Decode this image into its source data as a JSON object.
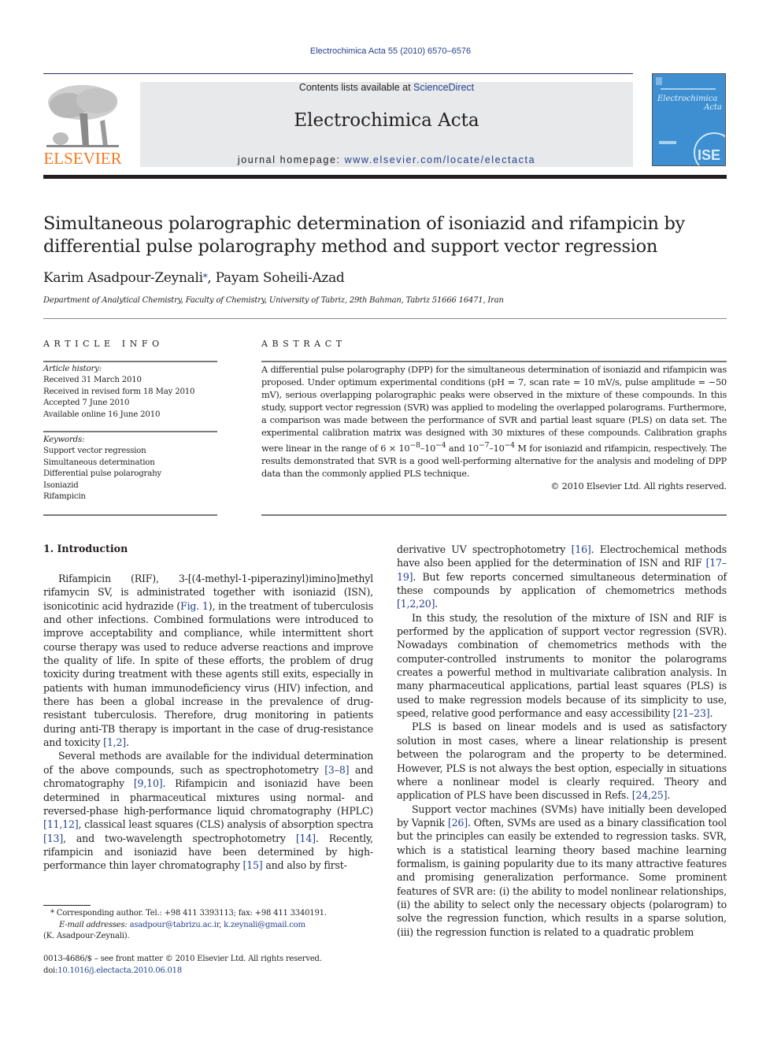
{
  "header": {
    "citation": "Electrochimica Acta 55 (2010) 6570–6576",
    "publisher_logo_text": "ELSEVIER",
    "contents_prefix": "Contents lists available at ",
    "contents_link": "ScienceDirect",
    "journal_title": "Electrochimica Acta",
    "homepage_prefix": "journal homepage: ",
    "homepage_link": "www.elsevier.com/locate/electacta",
    "cover": {
      "title_line1": "Electrochimica",
      "title_line2": "Acta",
      "seal_text": "ISE"
    }
  },
  "article": {
    "title": "Simultaneous polarographic determination of isoniazid and rifampicin by differential pulse polarography method and support vector regression",
    "authors": {
      "author1": "Karim Asadpour-Zeynali",
      "author1_mark": "*",
      "separator": ", ",
      "author2": "Payam Soheili-Azad"
    },
    "affiliation": "Department of Analytical Chemistry, Faculty of Chemistry, University of Tabriz, 29th Bahman, Tabriz 51666 16471, Iran"
  },
  "article_info": {
    "heading": "ARTICLE INFO",
    "history_label": "Article history:",
    "history": [
      "Received 31 March 2010",
      "Received in revised form 18 May 2010",
      "Accepted 7 June 2010",
      "Available online 16 June 2010"
    ],
    "keywords_label": "Keywords:",
    "keywords": [
      "Support vector regression",
      "Simultaneous determination",
      "Differential pulse polarograhy",
      "Isoniazid",
      "Rifampicin"
    ]
  },
  "abstract": {
    "heading": "ABSTRACT",
    "text_part1": "A differential pulse polarography (DPP) for the simultaneous determination of isoniazid and rifampicin was proposed. Under optimum experimental conditions (pH = 7, scan rate = 10 mV/s, pulse amplitude = −50 mV), serious overlapping polarographic peaks were observed in the mixture of these compounds. In this study, support vector regression (SVR) was applied to modeling the overlapped polarograms. Furthermore, a comparison was made between the performance of SVR and partial least square (PLS) on data set. The experimental calibration matrix was designed with 30 mixtures of these compounds. Calibration graphs were linear in the range of 6 × 10",
    "exp1": "−8",
    "text_part2": "–10",
    "exp2": "−4",
    "text_part3": " and 10",
    "exp3": "−7",
    "text_part4": "–10",
    "exp4": "−4",
    "text_part5": " M for isoniazid and rifampicin, respectively. The results demonstrated that SVR is a good well-performing alternative for the analysis and modeling of DPP data than the commonly applied PLS technique.",
    "copyright": "© 2010 Elsevier Ltd. All rights reserved."
  },
  "introduction": {
    "heading": "1.  Introduction",
    "p1": {
      "a": "Rifampicin (RIF), 3-[(4-methyl-1-piperazinyl)imino]methyl rifamycin SV, is administrated together with isoniazid (ISN), isonicotinic acid hydrazide (",
      "ref1": "Fig. 1",
      "b": "), in the treatment of tuberculosis and other infections. Combined formulations were introduced to improve acceptability and compliance, while intermittent short course therapy was used to reduce adverse reactions and improve the quality of life. In spite of these efforts, the problem of drug toxicity during treatment with these agents still exits, especially in patients with human immunodeficiency virus (HIV) infection, and there has been a global increase in the prevalence of drug-resistant tuberculosis. Therefore, drug monitoring in patients during anti-TB therapy is important in the case of drug-resistance and toxicity ",
      "ref2": "[1,2]",
      "c": "."
    },
    "p2": {
      "a": "Several methods are available for the individual determination of the above compounds, such as spectrophotometry ",
      "ref1": "[3–8]",
      "b": " and chromatography ",
      "ref2": "[9,10]",
      "c": ". Rifampicin and isoniazid have been determined in pharmaceutical mixtures using normal- and reversed-phase high-performance liquid chromatography (HPLC) ",
      "ref3": "[11,12]",
      "d": ", classical least squares (CLS) analysis of absorption spectra ",
      "ref4": "[13]",
      "e": ", and two-wavelength spectrophotometry ",
      "ref5": "[14]",
      "f": ". Recently, rifampicin and isoniazid have been determined by high-performance thin layer chromatography ",
      "ref6": "[15]",
      "g": " and also by first-"
    },
    "p3": {
      "a": "derivative UV spectrophotometry ",
      "ref1": "[16]",
      "b": ". Electrochemical methods have also been applied for the determination of ISN and RIF ",
      "ref2": "[17–19]",
      "c": ". But few reports concerned simultaneous determination of these compounds by application of chemometrics methods ",
      "ref3": "[1,2,20]",
      "d": "."
    },
    "p4": {
      "a": "In this study, the resolution of the mixture of ISN and RIF is performed by the application of support vector regression (SVR). Nowadays combination of chemometrics methods with the computer-controlled instruments to monitor the polarograms creates a powerful method in multivariate calibration analysis. In many pharmaceutical applications, partial least squares (PLS) is used to make regression models because of its simplicity to use, speed, relative good performance and easy accessibility ",
      "ref1": "[21–23]",
      "b": "."
    },
    "p5": {
      "a": "PLS is based on linear models and is used as satisfactory solution in most cases, where a linear relationship is present between the polarogram and the property to be determined. However, PLS is not always the best option, especially in situations where a nonlinear model is clearly required. Theory and application of PLS have been discussed in Refs. ",
      "ref1": "[24,25]",
      "b": "."
    },
    "p6": {
      "a": "Support vector machines (SVMs) have initially been developed by Vapnik ",
      "ref1": "[26]",
      "b": ". Often, SVMs are used as a binary classification tool but the principles can easily be extended to regression tasks. SVR, which is a statistical learning theory based machine learning formalism, is gaining popularity due to its many attractive features and promising generalization performance. Some prominent features of SVR are: (i) the ability to model nonlinear relationships, (ii) the ability to select only the necessary objects (polarogram) to solve the regression function, which results in a sparse solution, (iii) the regression function is related to a quadratic problem"
    }
  },
  "footnote": {
    "corresponding": "* Corresponding author. Tel.: +98 411 3393113; fax: +98 411 3340191.",
    "email_label": "E-mail addresses:",
    "email1": "asadpour@tabrizu.ac.ir",
    "email_sep": ", ",
    "email2": "k.zeynali@gmail.com",
    "owner": "(K. Asadpour-Zeynali)."
  },
  "front_matter": {
    "issn_line": "0013-4686/$ – see front matter © 2010 Elsevier Ltd. All rights reserved.",
    "doi_label": "doi:",
    "doi": "10.1016/j.electacta.2010.06.018"
  }
}
